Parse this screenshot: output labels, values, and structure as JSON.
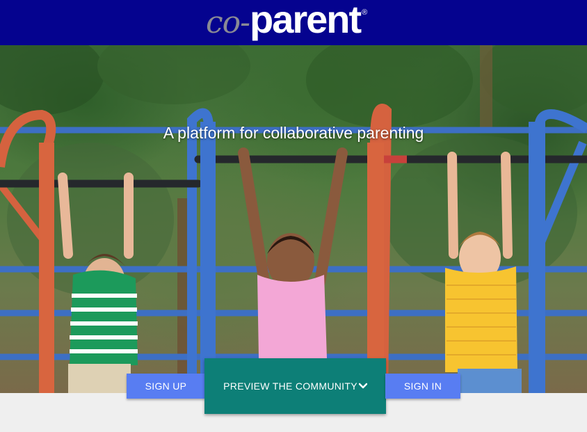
{
  "header": {
    "logo_prefix": "co-",
    "logo_main": "parent",
    "logo_mark": "®"
  },
  "hero": {
    "tagline": "A platform for collaborative parenting"
  },
  "actions": {
    "sign_up": "SIGN UP",
    "preview": "PREVIEW THE COMMUNITY",
    "sign_in": "SIGN IN"
  },
  "colors": {
    "header_bg": "#05038f",
    "button_blue": "#587df2",
    "button_teal": "#0d7f77",
    "page_bg": "#efefef"
  }
}
